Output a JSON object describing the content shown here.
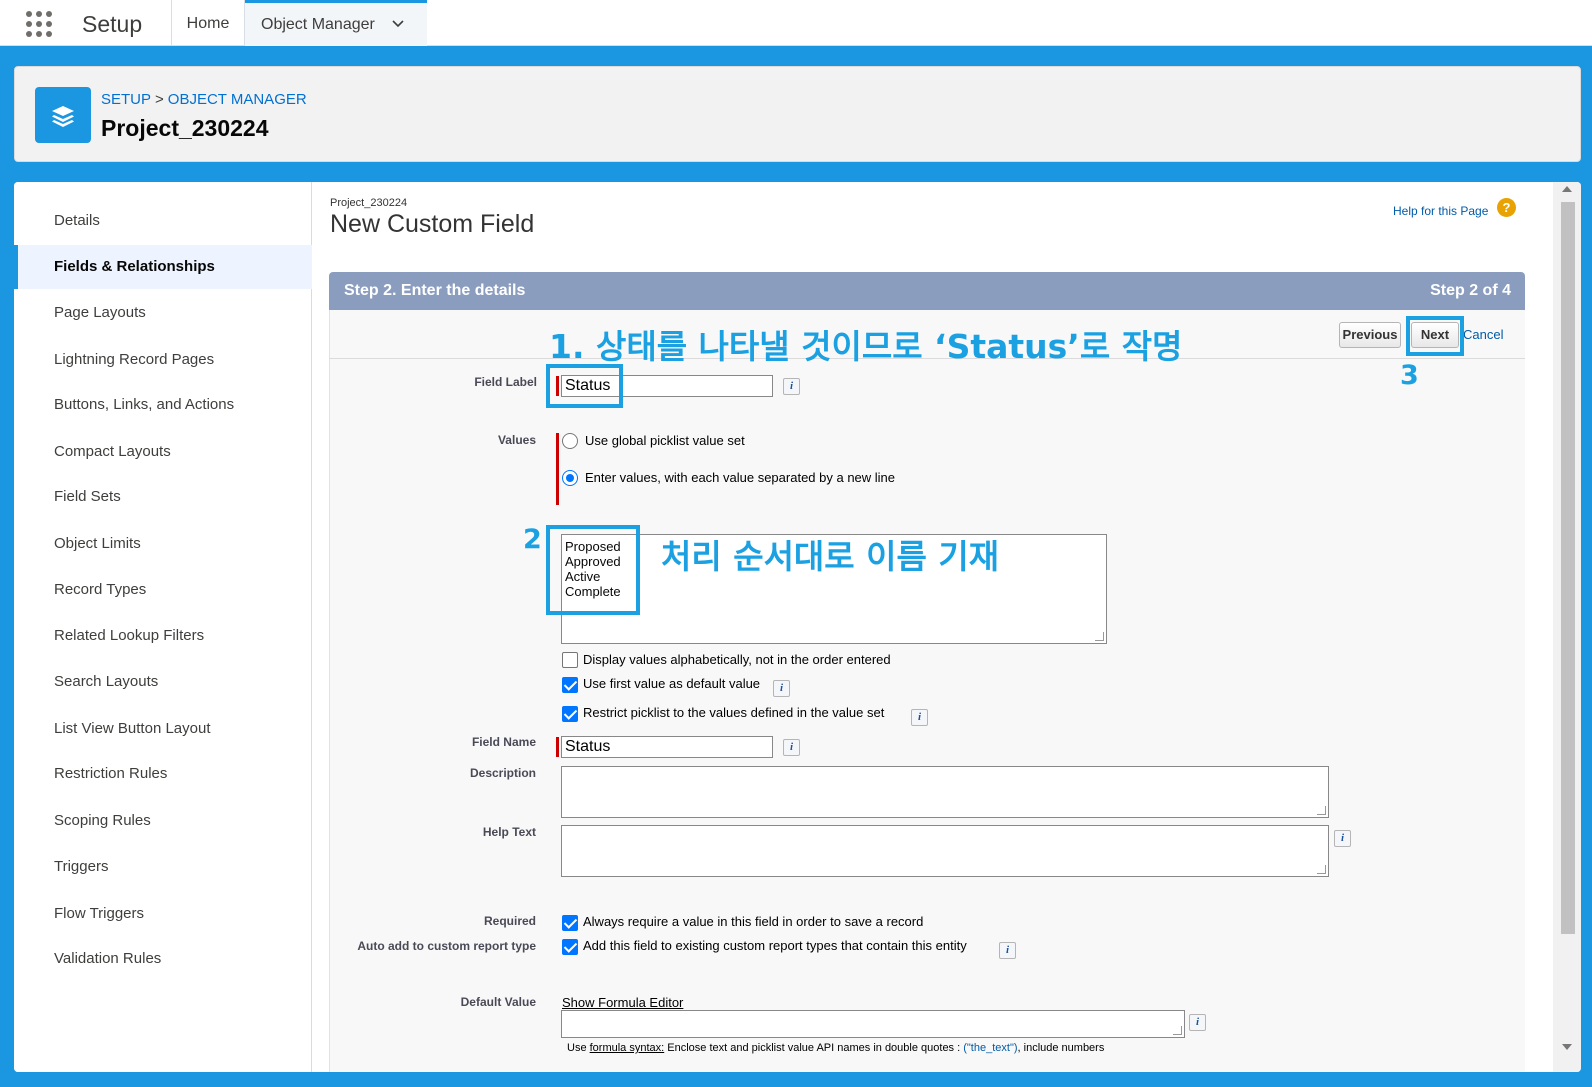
{
  "topbar": {
    "app_name": "Setup",
    "nav_home": "Home",
    "nav_object_manager": "Object Manager"
  },
  "header": {
    "breadcrumb_setup": "SETUP",
    "breadcrumb_sep": ">",
    "breadcrumb_om": "OBJECT MANAGER",
    "title": "Project_230224"
  },
  "sidebar": {
    "items": [
      {
        "label": "Details"
      },
      {
        "label": "Fields & Relationships"
      },
      {
        "label": "Page Layouts"
      },
      {
        "label": "Lightning Record Pages"
      },
      {
        "label": "Buttons, Links, and Actions"
      },
      {
        "label": "Compact Layouts"
      },
      {
        "label": "Field Sets"
      },
      {
        "label": "Object Limits"
      },
      {
        "label": "Record Types"
      },
      {
        "label": "Related Lookup Filters"
      },
      {
        "label": "Search Layouts"
      },
      {
        "label": "List View Button Layout"
      },
      {
        "label": "Restriction Rules"
      },
      {
        "label": "Scoping Rules"
      },
      {
        "label": "Triggers"
      },
      {
        "label": "Flow Triggers"
      },
      {
        "label": "Validation Rules"
      }
    ]
  },
  "content": {
    "object_name": "Project_230224",
    "page_title": "New Custom Field",
    "help_link": "Help for this Page",
    "help_icon": "?",
    "step_title": "Step 2. Enter the details",
    "step_count": "Step 2 of 4",
    "btn_previous": "Previous",
    "btn_next": "Next",
    "btn_cancel": "Cancel"
  },
  "form": {
    "field_label_label": "Field Label",
    "field_label_value": "Status",
    "values_label": "Values",
    "radio_global": "Use global picklist value set",
    "radio_enter": "Enter values, with each value separated by a new line",
    "picklist_values": [
      "Proposed",
      "Approved",
      "Active",
      "Complete"
    ],
    "chk_alpha": "Display values alphabetically, not in the order entered",
    "chk_first_default": "Use first value as default value",
    "chk_restrict": "Restrict picklist to the values defined in the value set",
    "field_name_label": "Field Name",
    "field_name_value": "Status",
    "description_label": "Description",
    "help_text_label": "Help Text",
    "required_label": "Required",
    "required_text": "Always require a value in this field in order to save a record",
    "auto_add_label": "Auto add to custom report type",
    "auto_add_text": "Add this field to existing custom report types that contain this entity",
    "default_value_label": "Default Value",
    "show_formula_editor": "Show Formula Editor",
    "formula_help_prefix": "Use ",
    "formula_help_link": "formula syntax:",
    "formula_help_mid": " Enclose text and picklist value API names in double quotes : ",
    "formula_help_example": "(\"the_text\")",
    "formula_help_suffix": ", include numbers",
    "info_icon": "i"
  },
  "annotations": {
    "note1": "1. 상태를 나타낼 것이므로 ‘Status’로 작명",
    "note2_num": "2",
    "note2": "처리 순서대로 이름 기재",
    "note3": "3",
    "color": "#1ba1e2"
  }
}
